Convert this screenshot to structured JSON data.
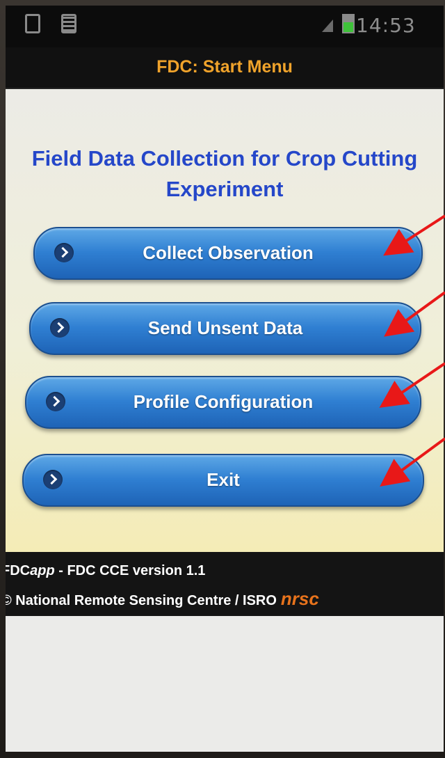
{
  "status_bar": {
    "time": "14:53",
    "left_icons": [
      "download-icon",
      "sd-card-icon"
    ],
    "right_icons": [
      "signal-icon",
      "battery-icon"
    ]
  },
  "app": {
    "title": "FDC: Start Menu"
  },
  "main": {
    "headline": "Field Data Collection for Crop Cutting Experiment",
    "buttons": [
      {
        "label": "Collect Observation",
        "icon": "chevron-right-icon"
      },
      {
        "label": "Send Unsent Data",
        "icon": "chevron-right-icon"
      },
      {
        "label": "Profile Configuration",
        "icon": "chevron-right-icon"
      },
      {
        "label": "Exit",
        "icon": "chevron-right-icon"
      }
    ]
  },
  "footer": {
    "app_name_prefix": "FDC",
    "app_name_suffix": "app",
    "version_text": " - FDC CCE version 1.1",
    "copyright": "© National Remote Sensing Centre / ISRO",
    "logo_text": "nrsc"
  },
  "colors": {
    "title": "#f0a32b",
    "headline": "#2547c9",
    "button": "#2f7fd2",
    "logo": "#e8731c",
    "annotation_arrow": "#e81818"
  }
}
